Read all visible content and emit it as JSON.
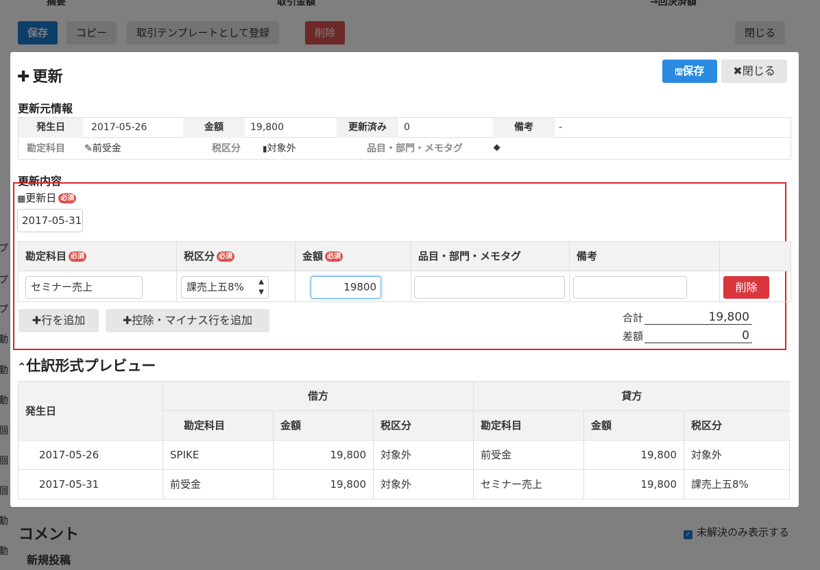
{
  "background": {
    "header_cols": [
      "摘要",
      "取引金額",
      "→回決済額"
    ],
    "toolbar": {
      "save": "保存",
      "copy": "コピー",
      "register_template": "取引テンプレートとして登録",
      "delete": "削除",
      "close": "閉じる"
    },
    "left_labels": [
      "プ",
      "プ",
      "プ",
      "動",
      "動",
      "動",
      "個",
      "個",
      "個",
      "動",
      "動"
    ],
    "comment": {
      "title": "コメント",
      "new_post": "新規投稿",
      "unresolved_only": "未解決のみ表示する",
      "unresolved_checked": true
    }
  },
  "modal": {
    "title": "更新",
    "save_button": "保存",
    "close_button": "閉じる",
    "source_section": "更新元情報",
    "source": {
      "date_label": "発生日",
      "date_value": "2017-05-26",
      "amount_label": "金額",
      "amount_value": "19,800",
      "updated_label": "更新済み",
      "updated_value": "0",
      "note_label": "備考",
      "note_value": "-",
      "account_label": "勘定科目",
      "account_value": "前受金",
      "tax_label": "税区分",
      "tax_value": "対象外",
      "tags_label": "品目・部門・メモタグ"
    },
    "content_section": "更新内容",
    "update_date_label": "更新日",
    "required_badge": "必須",
    "update_date_value": "2017-05-31",
    "entry_headers": {
      "account": "勘定科目",
      "tax": "税区分",
      "amount": "金額",
      "tags": "品目・部門・メモタグ",
      "note": "備考"
    },
    "entry_row": {
      "account": "セミナー売上",
      "tax": "課売上五8%",
      "amount": "19800",
      "tags": "",
      "note": "",
      "delete": "削除"
    },
    "add_row": "行を追加",
    "add_minus_row": "控除・マイナス行を追加",
    "total_label": "合計",
    "total_value": "19,800",
    "diff_label": "差額",
    "diff_value": "0",
    "preview_title": "仕訳形式プレビュー",
    "preview": {
      "date_header": "発生日",
      "debit_header": "借方",
      "credit_header": "貸方",
      "sub_headers": [
        "勘定科目",
        "金額",
        "税区分"
      ],
      "rows": [
        {
          "date": "2017-05-26",
          "d_account": "SPIKE",
          "d_amount": "19,800",
          "d_tax": "対象外",
          "c_account": "前受金",
          "c_amount": "19,800",
          "c_tax": "対象外"
        },
        {
          "date": "2017-05-31",
          "d_account": "前受金",
          "d_amount": "19,800",
          "d_tax": "対象外",
          "c_account": "セミナー売上",
          "c_amount": "19,800",
          "c_tax": "課売上五8%"
        }
      ]
    }
  }
}
